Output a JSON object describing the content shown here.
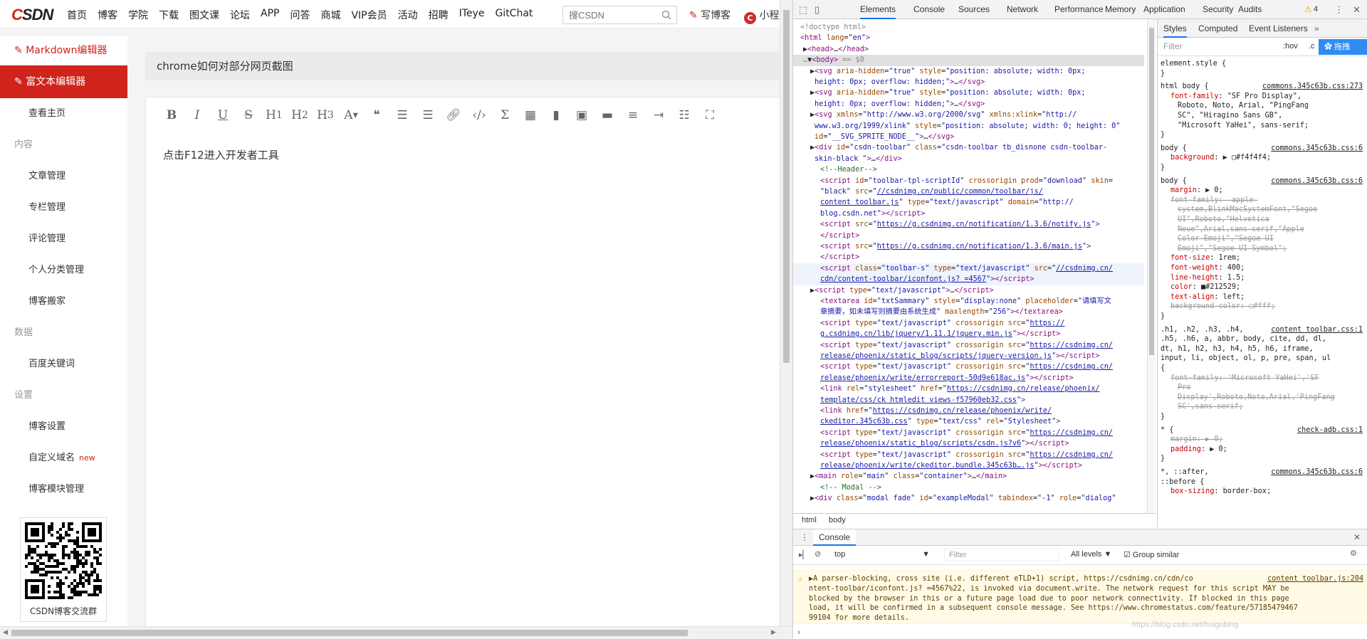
{
  "site": {
    "logo": "CSDN",
    "nav": [
      "首页",
      "博客",
      "学院",
      "下载",
      "图文课",
      "论坛",
      "APP",
      "问答",
      "商城",
      "VIP会员",
      "活动",
      "招聘",
      "ITeye",
      "GitChat"
    ],
    "search_placeholder": "搜CSDN",
    "write_blog": "写博客",
    "program": "小程"
  },
  "sidebar": {
    "top": "Markdown编辑器",
    "active": "富文本编辑器",
    "items": [
      "查看主页"
    ],
    "sec1": "内容",
    "content_items": [
      "文章管理",
      "专栏管理",
      "评论管理",
      "个人分类管理",
      "博客搬家"
    ],
    "sec2": "数据",
    "data_items": [
      "百度关键词"
    ],
    "sec3": "设置",
    "settings_items": [
      "博客设置",
      "自定义域名",
      "博客模块管理"
    ],
    "new_badge": "new",
    "qr_caption": "CSDN博客交流群"
  },
  "editor": {
    "title": "chrome如何对部分网页截图",
    "body": "点击F12进入开发者工具"
  },
  "devtools": {
    "tabs": [
      "Elements",
      "Console",
      "Sources",
      "Network",
      "Performance",
      "Memory",
      "Application",
      "Security",
      "Audits"
    ],
    "warn_count": "4",
    "styles_tabs": [
      "Styles",
      "Computed",
      "Event Listeners"
    ],
    "filter": "Filter",
    "hov": ":hov",
    "crumbs": [
      "html",
      "body"
    ],
    "console_title": "Console",
    "context": "top",
    "console_filter": "Filter",
    "levels": "All levels",
    "group_similar": "Group similar",
    "warning_lines": [
      "A parser-blocking, cross site (i.e. different eTLD+1) script, https://csdnimg.cn/cdn/co",
      "ntent-toolbar/iconfont.js? =4567%22, is invoked via document.write. The network request for this script MAY be",
      "blocked by the browser in this or a future page load due to poor network connectivity. If blocked in this page",
      "load, it will be confirmed in a subsequent console message. See https://www.chromestatus.com/feature/57185479467",
      "99104 for more details."
    ],
    "warning_source": "content toolbar.js:204"
  },
  "watermark": "https://blog.csdn.net/huigubing"
}
